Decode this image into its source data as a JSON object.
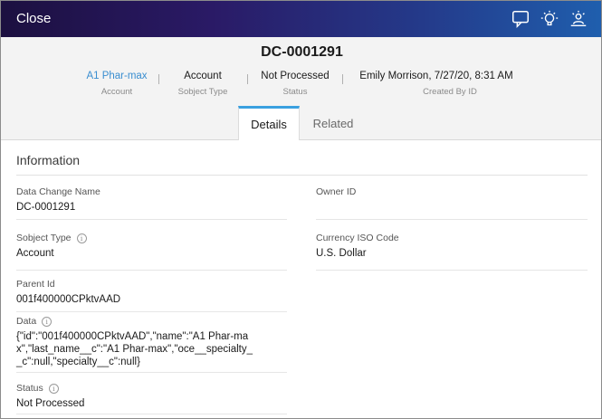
{
  "window": {
    "close_label": "Close"
  },
  "top_icons": [
    "chat-icon",
    "lightbulb-icon",
    "sunrise-user-icon"
  ],
  "record": {
    "title": "DC-0001291",
    "fields": [
      {
        "value": "A1 Phar-max",
        "label": "Account",
        "is_link": true
      },
      {
        "value": "Account",
        "label": "Sobject Type"
      },
      {
        "value": "Not Processed",
        "label": "Status"
      },
      {
        "value": "Emily Morrison, 7/27/20, 8:31 AM",
        "label": "Created By ID"
      }
    ]
  },
  "tabs": [
    {
      "label": "Details",
      "active": true
    },
    {
      "label": "Related",
      "active": false
    }
  ],
  "section": {
    "title": "Information",
    "left_items": [
      {
        "label": "Data Change Name",
        "value": "DC-0001291",
        "info": false
      },
      {
        "label": "Sobject Type",
        "value": "Account",
        "info": true
      },
      {
        "label": "Parent Id",
        "value": "001f400000CPktvAAD",
        "info": false
      },
      {
        "label": "Data",
        "value": "{\"id\":\"001f400000CPktvAAD\",\"name\":\"A1 Phar-max\",\"last_name__c\":\"A1 Phar-max\",\"oce__specialty__c\":null,\"specialty__c\":null}",
        "info": true
      },
      {
        "label": "Status",
        "value": "Not Processed",
        "info": true
      }
    ],
    "right_items": [
      {
        "label": "Owner ID",
        "value": ""
      },
      {
        "label": "Currency ISO Code",
        "value": "U.S. Dollar"
      }
    ]
  },
  "colors": {
    "link": "#3a8ed0",
    "tab_accent": "#3aa0e0",
    "topbar_start": "#1c1040",
    "topbar_end": "#1f5fae"
  }
}
